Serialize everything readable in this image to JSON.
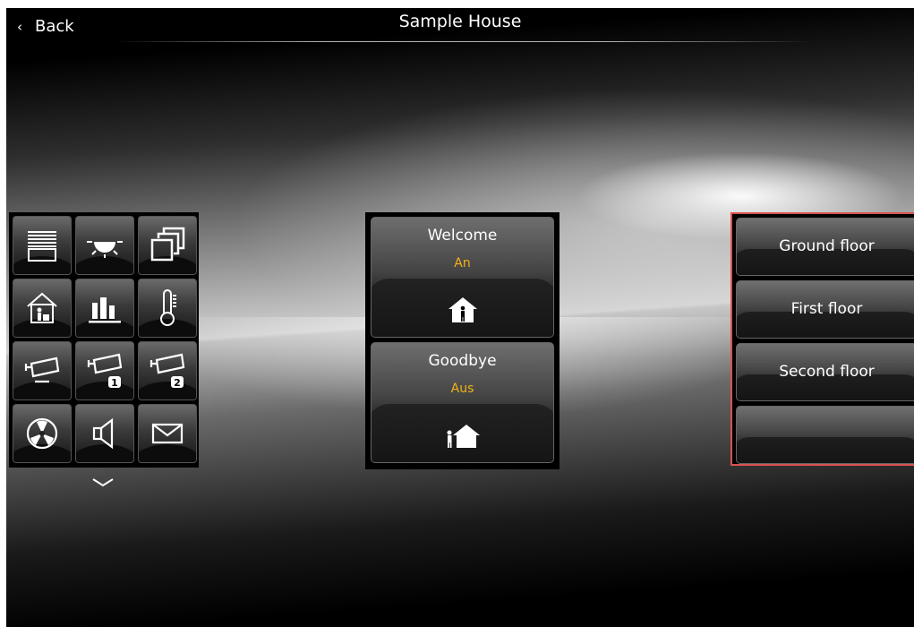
{
  "header": {
    "back_label": "Back",
    "title": "Sample House"
  },
  "icon_grid": {
    "tiles": [
      {
        "icon": "blinds-icon"
      },
      {
        "icon": "light-icon"
      },
      {
        "icon": "windows-stack-icon"
      },
      {
        "icon": "home-presence-icon"
      },
      {
        "icon": "bar-chart-icon"
      },
      {
        "icon": "thermometer-icon"
      },
      {
        "icon": "camera-icon"
      },
      {
        "icon": "camera-1-icon",
        "badge": "1"
      },
      {
        "icon": "camera-2-icon",
        "badge": "2"
      },
      {
        "icon": "fan-icon"
      },
      {
        "icon": "speaker-icon"
      },
      {
        "icon": "mail-icon"
      }
    ],
    "more_icon": "chevron-down-icon"
  },
  "scenes": [
    {
      "label": "Welcome",
      "state": "An",
      "icon": "person-in-house-icon"
    },
    {
      "label": "Goodbye",
      "state": "Aus",
      "icon": "person-leaving-house-icon"
    }
  ],
  "floors": [
    {
      "label": "Ground floor"
    },
    {
      "label": "First floor"
    },
    {
      "label": "Second floor"
    },
    {
      "label": ""
    }
  ],
  "colors": {
    "state_text": "#f2b315",
    "floor_panel_border": "#d9534f"
  }
}
